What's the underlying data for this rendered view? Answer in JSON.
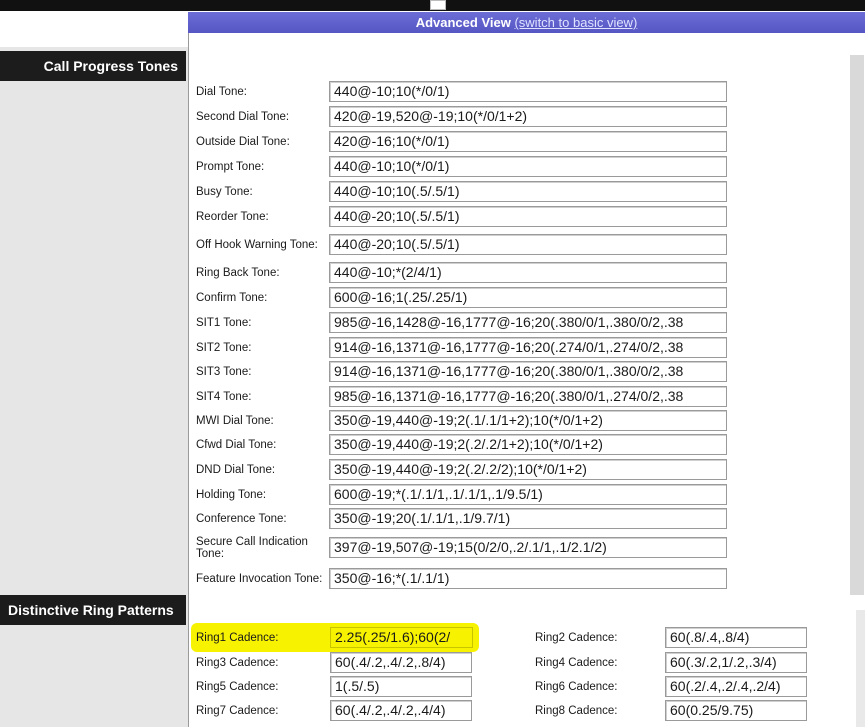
{
  "header": {
    "title": "Advanced View",
    "switch_link": "(switch to basic view)"
  },
  "sections": {
    "call_progress": "Call Progress Tones",
    "ring_patterns": "Distinctive Ring Patterns"
  },
  "tones": [
    {
      "label": "Dial Tone:",
      "value": "440@-10;10(*/0/1)"
    },
    {
      "label": "Second Dial Tone:",
      "value": "420@-19,520@-19;10(*/0/1+2)"
    },
    {
      "label": "Outside Dial Tone:",
      "value": "420@-16;10(*/0/1)"
    },
    {
      "label": "Prompt Tone:",
      "value": "440@-10;10(*/0/1)"
    },
    {
      "label": "Busy Tone:",
      "value": "440@-10;10(.5/.5/1)"
    },
    {
      "label": "Reorder Tone:",
      "value": "440@-20;10(.5/.5/1)"
    },
    {
      "label": "Off Hook Warning Tone:",
      "value": "440@-20;10(.5/.5/1)"
    },
    {
      "label": "Ring Back Tone:",
      "value": "440@-10;*(2/4/1)"
    },
    {
      "label": "Confirm Tone:",
      "value": "600@-16;1(.25/.25/1)"
    },
    {
      "label": "SIT1 Tone:",
      "value": "985@-16,1428@-16,1777@-16;20(.380/0/1,.380/0/2,.38"
    },
    {
      "label": "SIT2 Tone:",
      "value": "914@-16,1371@-16,1777@-16;20(.274/0/1,.274/0/2,.38"
    },
    {
      "label": "SIT3 Tone:",
      "value": "914@-16,1371@-16,1777@-16;20(.380/0/1,.380/0/2,.38"
    },
    {
      "label": "SIT4 Tone:",
      "value": "985@-16,1371@-16,1777@-16;20(.380/0/1,.274/0/2,.38"
    },
    {
      "label": "MWI Dial Tone:",
      "value": "350@-19,440@-19;2(.1/.1/1+2);10(*/0/1+2)"
    },
    {
      "label": "Cfwd Dial Tone:",
      "value": "350@-19,440@-19;2(.2/.2/1+2);10(*/0/1+2)"
    },
    {
      "label": "DND Dial Tone:",
      "value": "350@-19,440@-19;2(.2/.2/2);10(*/0/1+2)"
    },
    {
      "label": "Holding Tone:",
      "value": "600@-19;*(.1/.1/1,.1/.1/1,.1/9.5/1)"
    },
    {
      "label": "Conference Tone:",
      "value": "350@-19;20(.1/.1/1,.1/9.7/1)"
    },
    {
      "label": "Secure Call Indication Tone:",
      "value": "397@-19,507@-19;15(0/2/0,.2/.1/1,.1/2.1/2)"
    },
    {
      "label": "Feature Invocation Tone:",
      "value": "350@-16;*(.1/.1/1)"
    }
  ],
  "ring_cadences": [
    {
      "label": "Ring1 Cadence:",
      "value": "2.25(.25/1.6);60(2/"
    },
    {
      "label": "Ring2 Cadence:",
      "value": "60(.8/.4,.8/4)"
    },
    {
      "label": "Ring3 Cadence:",
      "value": "60(.4/.2,.4/.2,.8/4)"
    },
    {
      "label": "Ring4 Cadence:",
      "value": "60(.3/.2,1/.2,.3/4)"
    },
    {
      "label": "Ring5 Cadence:",
      "value": "1(.5/.5)"
    },
    {
      "label": "Ring6 Cadence:",
      "value": "60(.2/.4,.2/.4,.2/4)"
    },
    {
      "label": "Ring7 Cadence:",
      "value": "60(.4/.2,.4/.2,.4/4)"
    },
    {
      "label": "Ring8 Cadence:",
      "value": "60(0.25/9.75)"
    }
  ],
  "colors": {
    "header_bg": "#5f5fcf",
    "section_bg": "#1c1c1c",
    "highlight": "#f7f200"
  }
}
